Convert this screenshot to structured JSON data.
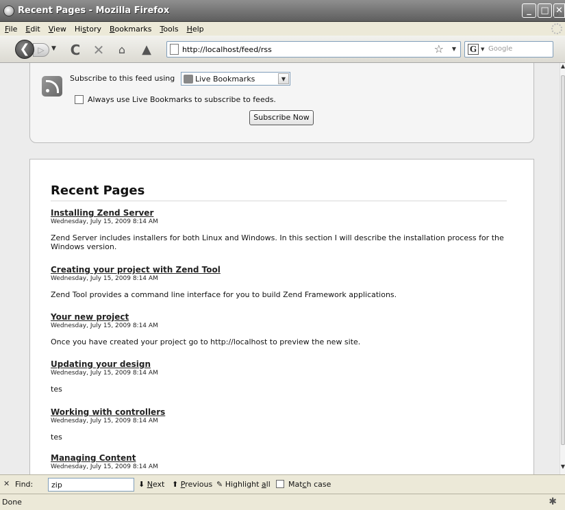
{
  "window": {
    "title": "Recent Pages - Mozilla Firefox"
  },
  "menu": [
    {
      "label": "File",
      "key": "F",
      "rest": "ile"
    },
    {
      "label": "Edit",
      "key": "E",
      "rest": "dit"
    },
    {
      "label": "View",
      "key": "V",
      "rest": "iew"
    },
    {
      "label": "History",
      "pre": "Hi",
      "key": "s",
      "rest": "tory"
    },
    {
      "label": "Bookmarks",
      "key": "B",
      "rest": "ookmarks"
    },
    {
      "label": "Tools",
      "key": "T",
      "rest": "ools"
    },
    {
      "label": "Help",
      "key": "H",
      "rest": "elp"
    }
  ],
  "nav": {
    "url": "http://localhost/feed/rss",
    "search_placeholder": "Google",
    "search_engine_letter": "G"
  },
  "subscribe": {
    "label": "Subscribe to this feed using",
    "reader": "Live Bookmarks",
    "always_label": "Always use Live Bookmarks to subscribe to feeds.",
    "always_checked": false,
    "button": "Subscribe Now"
  },
  "feed": {
    "title": "Recent Pages",
    "entries": [
      {
        "title": "Installing Zend Server",
        "date": "Wednesday, July 15, 2009 8:14 AM",
        "body": "Zend Server includes installers for both Linux and Windows. In this section I will describe the installation process for the Windows version."
      },
      {
        "title": "Creating your project with Zend Tool",
        "date": "Wednesday, July 15, 2009 8:14 AM",
        "body": "Zend Tool provides a command line interface for you to build Zend Framework applications."
      },
      {
        "title": "Your new project",
        "date": "Wednesday, July 15, 2009 8:14 AM",
        "body": "Once you have created your project go to http://localhost to preview the new site."
      },
      {
        "title": "Updating your design",
        "date": "Wednesday, July 15, 2009 8:14 AM",
        "body": "tes"
      },
      {
        "title": "Working with controllers",
        "date": "Wednesday, July 15, 2009 8:14 AM",
        "body": "tes"
      },
      {
        "title": "Managing Content",
        "date": "Wednesday, July 15, 2009 8:14 AM",
        "body": ""
      }
    ]
  },
  "find": {
    "label": "Find:",
    "value": "zip",
    "next": "Next",
    "next_key": "N",
    "next_rest": "ext",
    "previous": "Previous",
    "previous_key": "P",
    "previous_rest": "revious",
    "highlight_pre": "Highlight ",
    "highlight_key": "a",
    "highlight_rest": "ll",
    "match_pre": "Mat",
    "match_key": "c",
    "match_rest": "h case",
    "match_checked": false
  },
  "status": {
    "text": "Done"
  }
}
